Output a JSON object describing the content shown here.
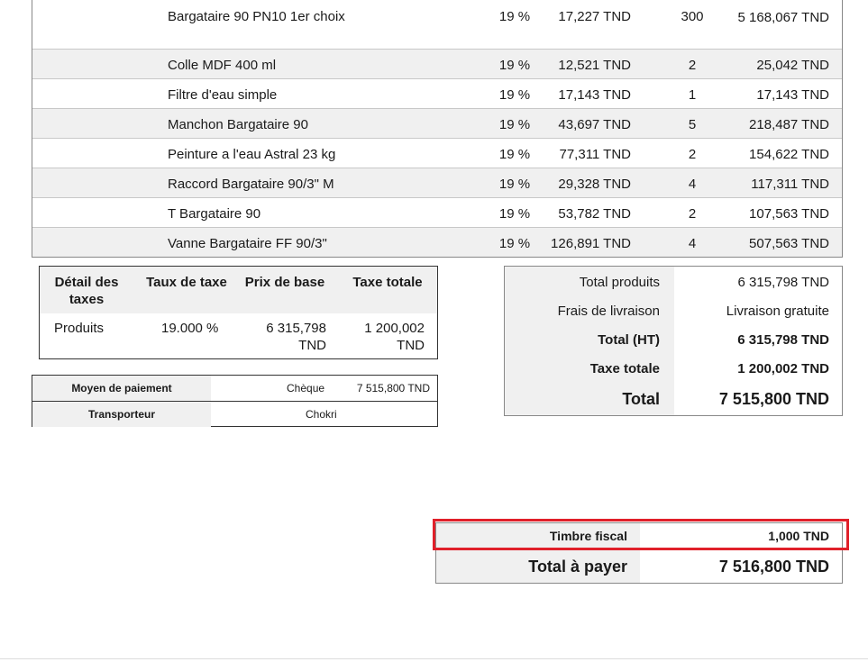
{
  "products": [
    {
      "name": "Bargataire 90 PN10 1er choix",
      "tax": "19 %",
      "unit_price": "17,227 TND",
      "qty": "300",
      "total": "5 168,067 TND"
    },
    {
      "name": "Colle MDF 400 ml",
      "tax": "19 %",
      "unit_price": "12,521 TND",
      "qty": "2",
      "total": "25,042 TND"
    },
    {
      "name": "Filtre d'eau simple",
      "tax": "19 %",
      "unit_price": "17,143 TND",
      "qty": "1",
      "total": "17,143 TND"
    },
    {
      "name": "Manchon Bargataire 90",
      "tax": "19 %",
      "unit_price": "43,697 TND",
      "qty": "5",
      "total": "218,487 TND"
    },
    {
      "name": "Peinture a l'eau Astral 23 kg",
      "tax": "19 %",
      "unit_price": "77,311 TND",
      "qty": "2",
      "total": "154,622 TND"
    },
    {
      "name": "Raccord Bargataire 90/3\" M",
      "tax": "19 %",
      "unit_price": "29,328 TND",
      "qty": "4",
      "total": "117,311 TND"
    },
    {
      "name": "T Bargataire 90",
      "tax": "19 %",
      "unit_price": "53,782 TND",
      "qty": "2",
      "total": "107,563 TND"
    },
    {
      "name": "Vanne Bargataire FF 90/3\"",
      "tax": "19 %",
      "unit_price": "126,891 TND",
      "qty": "4",
      "total": "507,563 TND"
    }
  ],
  "tax_detail": {
    "headers": {
      "detail": "Détail des taxes",
      "rate": "Taux de taxe",
      "base": "Prix de base",
      "total": "Taxe totale"
    },
    "row": {
      "label": "Produits",
      "rate": "19.000 %",
      "base": "6 315,798 TND",
      "total": "1 200,002 TND"
    }
  },
  "payment": {
    "method_label": "Moyen de paiement",
    "method_value": "Chèque",
    "method_amount": "7 515,800 TND",
    "carrier_label": "Transporteur",
    "carrier_value": "Chokri"
  },
  "totals": {
    "products_label": "Total produits",
    "products_value": "6 315,798 TND",
    "shipping_label": "Frais de livraison",
    "shipping_value": "Livraison gratuite",
    "ht_label": "Total (HT)",
    "ht_value": "6 315,798 TND",
    "tax_label": "Taxe totale",
    "tax_value": "1 200,002 TND",
    "total_label": "Total",
    "total_value": "7 515,800 TND"
  },
  "final": {
    "stamp_label": "Timbre fiscal",
    "stamp_value": "1,000 TND",
    "pay_label": "Total à payer",
    "pay_value": "7 516,800 TND"
  },
  "colors": {
    "highlight": "#e0202a",
    "shade": "#f0f0f0"
  }
}
